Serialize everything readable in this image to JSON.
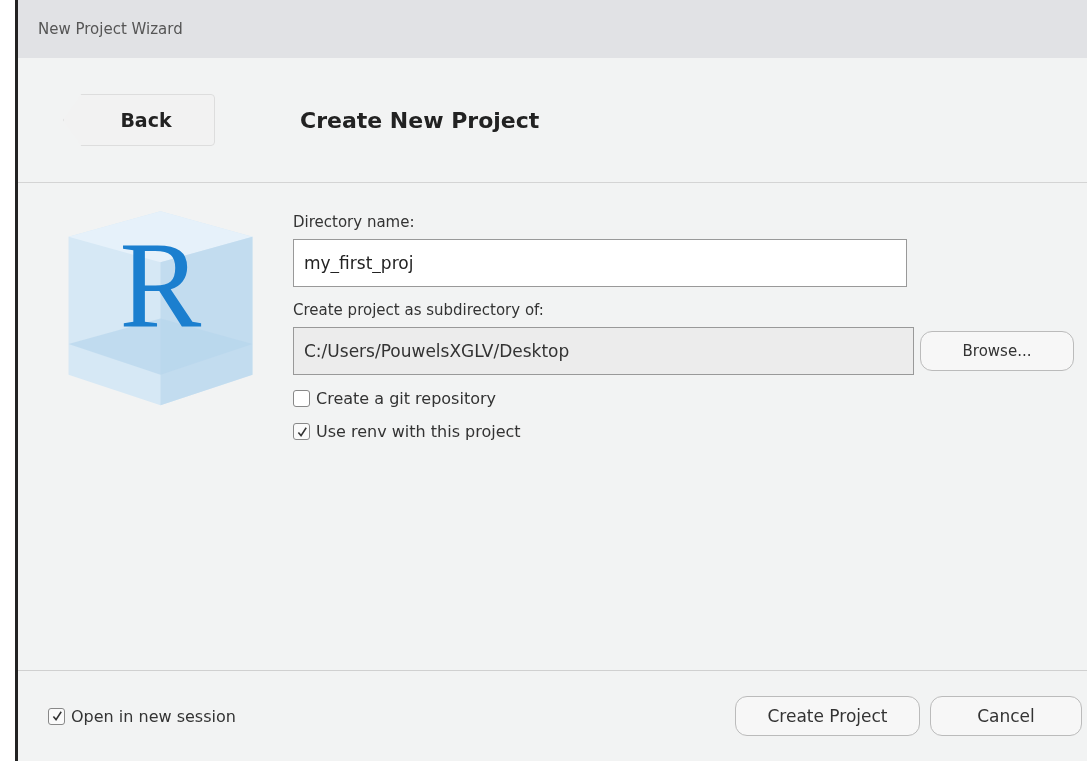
{
  "window": {
    "title": "New Project Wizard"
  },
  "header": {
    "back_button": "Back",
    "title": "Create New Project"
  },
  "logo": {
    "letter": "R"
  },
  "form": {
    "directory_label": "Directory name:",
    "directory_value": "my_first_proj",
    "parent_label": "Create project as subdirectory of:",
    "parent_value": "C:/Users/PouwelsXGLV/Desktop",
    "parent_disabled": true,
    "browse_button": "Browse...",
    "options": [
      {
        "label": "Create a git repository",
        "checked": false
      },
      {
        "label": "Use renv with this project",
        "checked": true
      }
    ]
  },
  "footer": {
    "open_new_session": {
      "label": "Open in new session",
      "checked": true
    },
    "buttons": [
      "Create Project",
      "Cancel"
    ]
  }
}
